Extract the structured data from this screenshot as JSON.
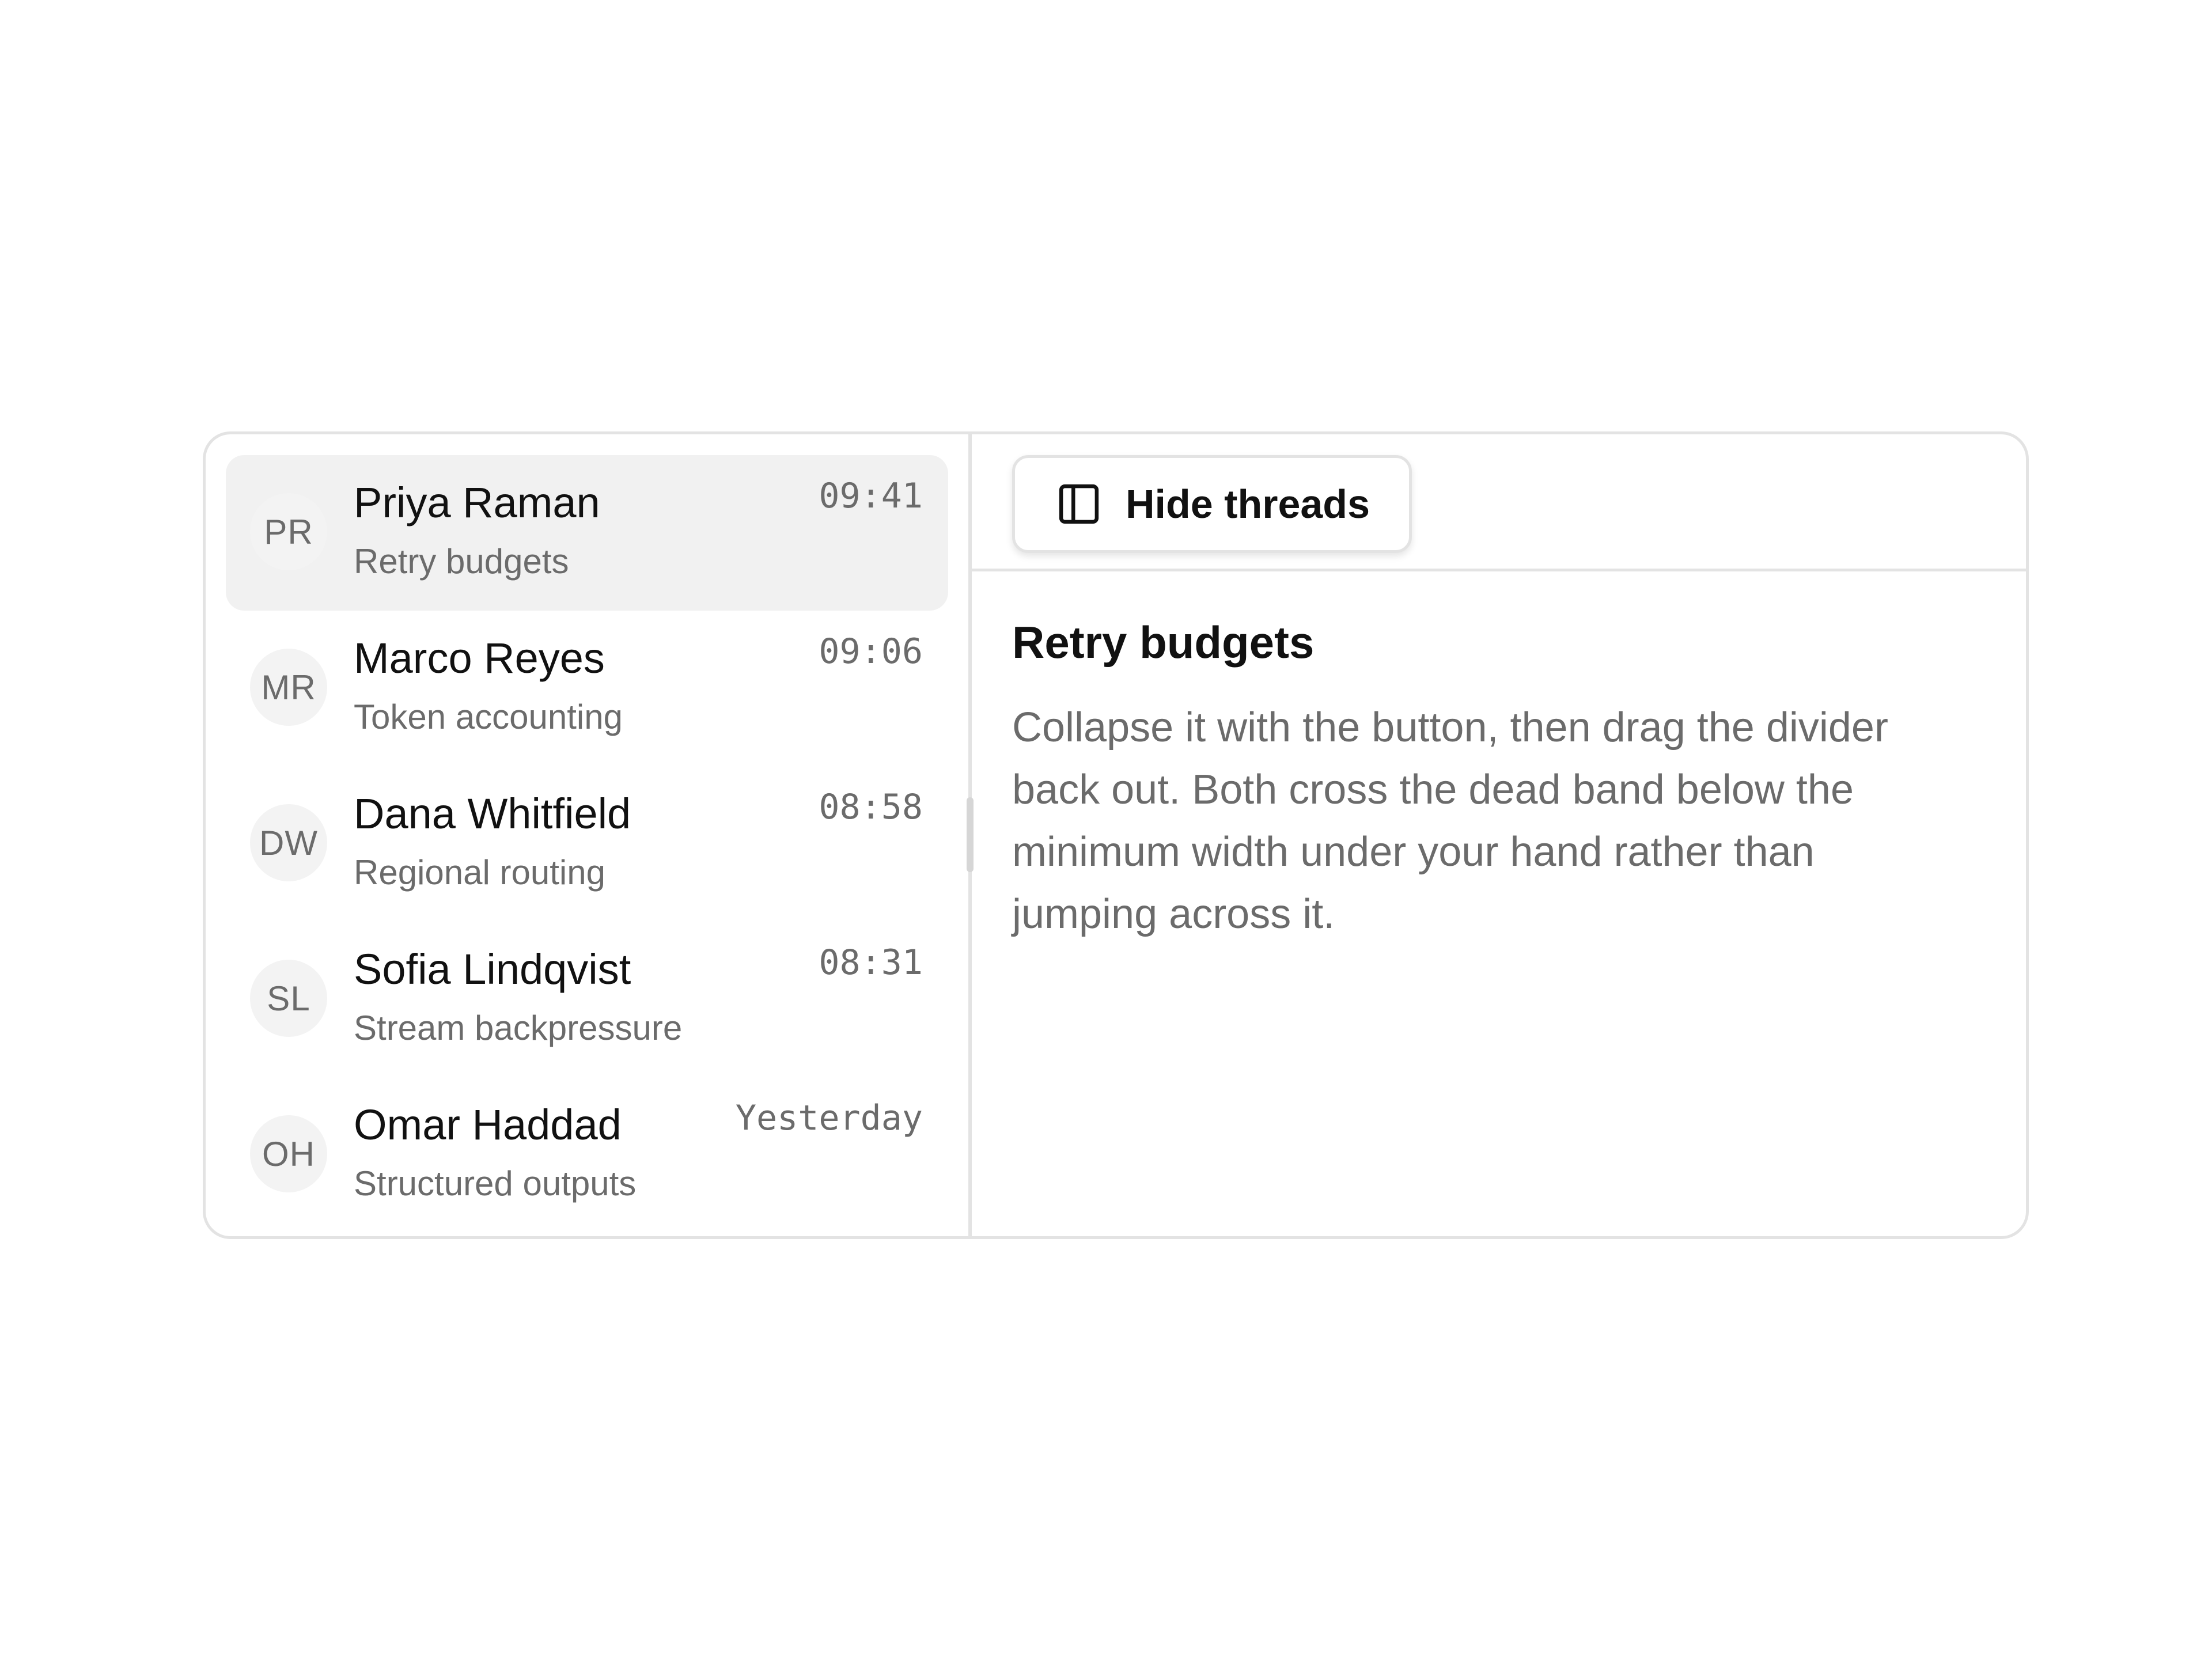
{
  "threads": [
    {
      "initials": "PR",
      "name": "Priya Raman",
      "subject": "Retry budgets",
      "time": "09:41",
      "selected": true
    },
    {
      "initials": "MR",
      "name": "Marco Reyes",
      "subject": "Token accounting",
      "time": "09:06",
      "selected": false
    },
    {
      "initials": "DW",
      "name": "Dana Whitfield",
      "subject": "Regional routing",
      "time": "08:58",
      "selected": false
    },
    {
      "initials": "SL",
      "name": "Sofia Lindqvist",
      "subject": "Stream backpressure",
      "time": "08:31",
      "selected": false
    },
    {
      "initials": "OH",
      "name": "Omar Haddad",
      "subject": "Structured outputs",
      "time": "Yesterday",
      "selected": false
    }
  ],
  "toolbar": {
    "toggle_label": "Hide threads",
    "toggle_icon": "sidebar-panel-icon"
  },
  "detail": {
    "title": "Retry budgets",
    "body": "Collapse it with the button, then drag the divider back out. Both cross the dead band below the minimum width under your hand rather than jumping across it."
  },
  "colors": {
    "border": "#e3e3e3",
    "selected_row": "#f1f1f1",
    "muted_text": "#6b6b6b",
    "primary_text": "#111111"
  }
}
